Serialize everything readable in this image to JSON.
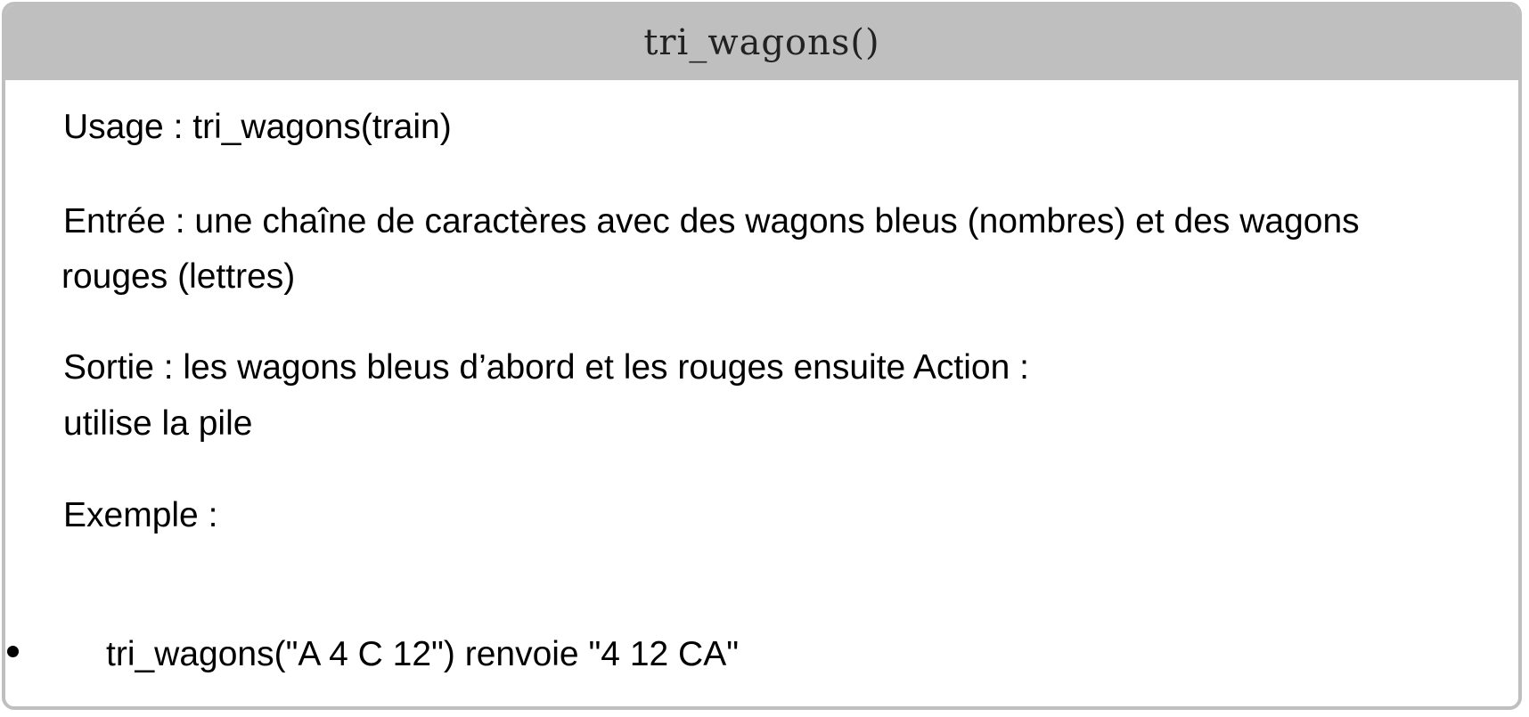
{
  "header": {
    "title": "tri_wagons()"
  },
  "usage": {
    "text": "Usage : tri_wagons(train)"
  },
  "entree": {
    "line1": "Entrée : une chaîne de caractères avec des wagons bleus (nombres) et des wagons",
    "line2": "rouges (lettres)"
  },
  "sortie": {
    "line1": "Sortie : les wagons bleus d’abord et les rouges ensuite Action :",
    "line2": "utilise la pile"
  },
  "exemple": {
    "label": "Exemple :",
    "items": [
      "tri_wagons(\"A 4 C 12\") renvoie \"4 12 CA\""
    ]
  }
}
